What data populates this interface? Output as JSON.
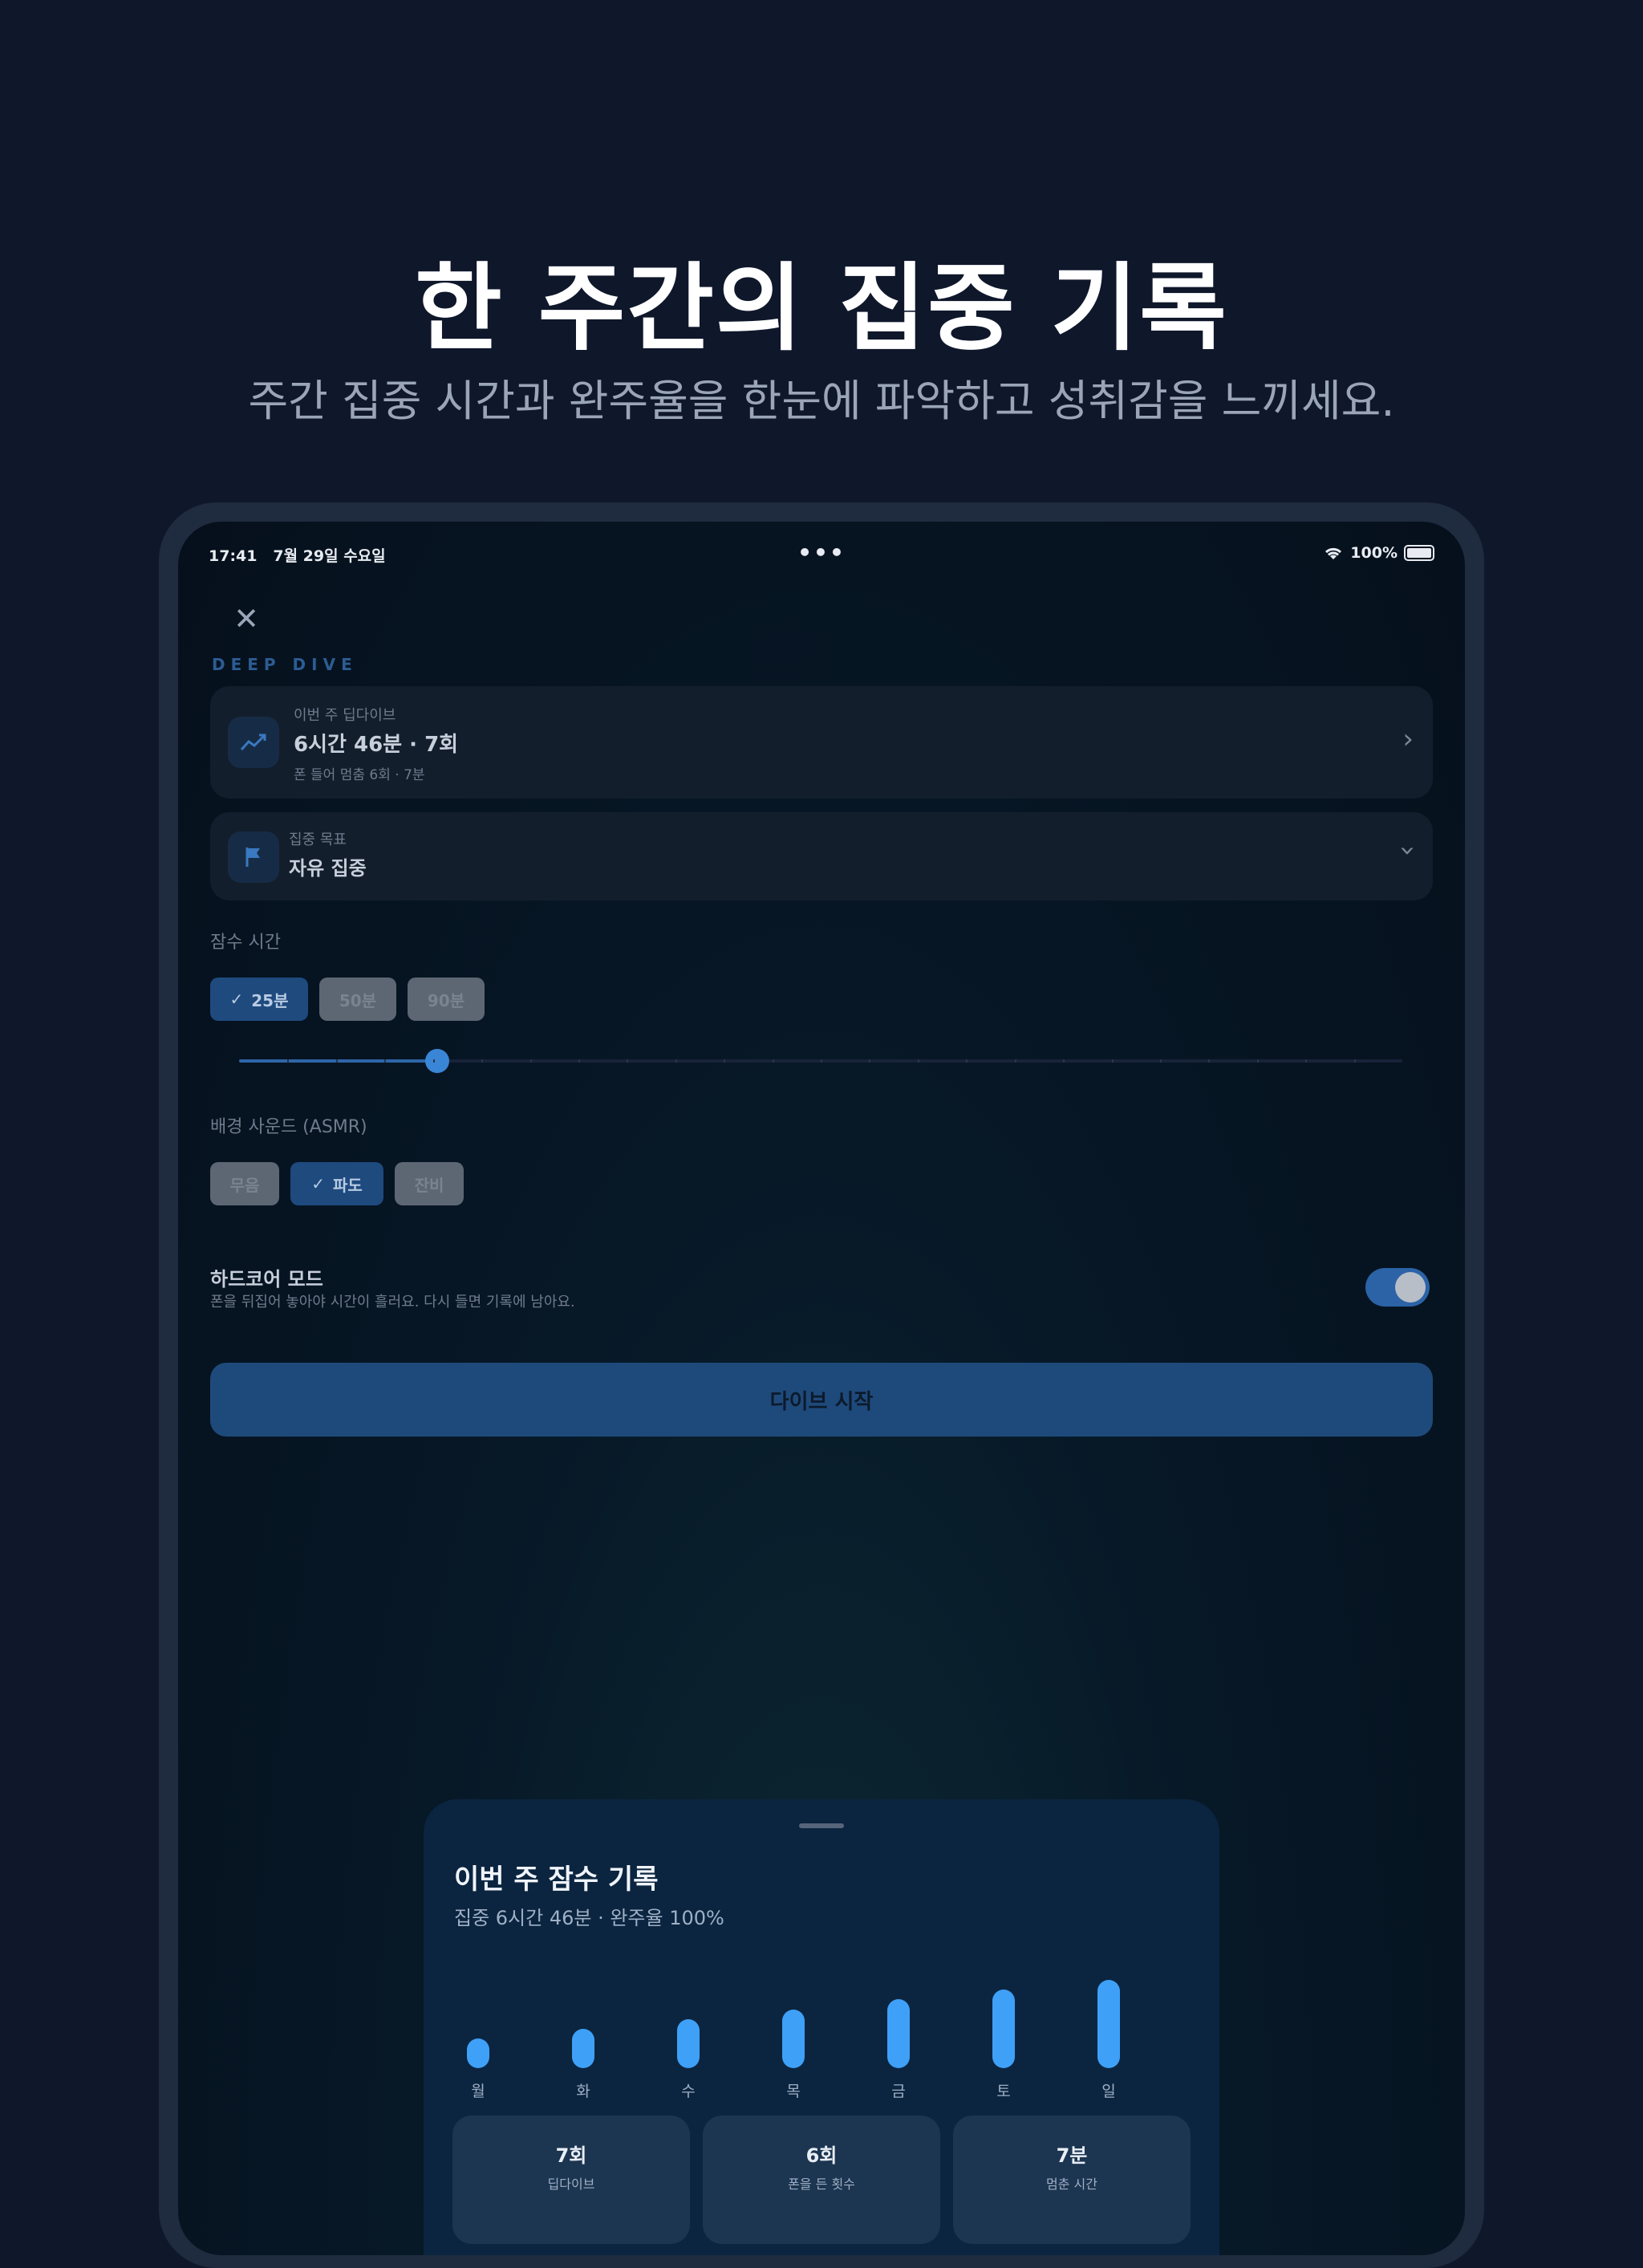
{
  "hero": {
    "title": "한 주간의 집중 기록",
    "subtitle": "주간 집중 시간과 완주율을 한눈에 파악하고 성취감을 느끼세요."
  },
  "status_bar": {
    "time": "17:41",
    "date": "7월 29일 수요일",
    "battery": "100%"
  },
  "app": {
    "brand": "DEEP DIVE",
    "weekly_card": {
      "label": "이번 주 딥다이브",
      "value": "6시간 46분 · 7회",
      "sub": "폰 들어 멈춤 6회 · 7분"
    },
    "goal_card": {
      "label": "집중 목표",
      "value": "자유 집중"
    },
    "dive_time": {
      "label": "잠수 시간",
      "options": [
        "25분",
        "50분",
        "90분"
      ],
      "selected": "25분",
      "slider_fraction": 0.17
    },
    "sound": {
      "label": "배경 사운드 (ASMR)",
      "options": [
        "무음",
        "파도",
        "잔비"
      ],
      "selected": "파도"
    },
    "hardcore": {
      "title": "하드코어 모드",
      "desc": "폰을 뒤집어 놓아야 시간이 흘러요. 다시 들면 기록에 남아요.",
      "enabled": true
    },
    "start_button": "다이브 시작"
  },
  "sheet": {
    "title": "이번 주 잠수 기록",
    "subtitle": "집중 6시간 46분 · 완주율 100%"
  },
  "chart_data": {
    "type": "bar",
    "categories": [
      "월",
      "화",
      "수",
      "목",
      "금",
      "토",
      "일"
    ],
    "values": [
      3,
      4,
      5,
      6,
      7,
      8,
      9
    ]
  },
  "stats": [
    {
      "value": "7회",
      "label": "딥다이브"
    },
    {
      "value": "6회",
      "label": "폰을 든 횟수"
    },
    {
      "value": "7분",
      "label": "멈춘 시간"
    }
  ],
  "colors": {
    "background": "#0f172b",
    "accent": "#3fa0f7",
    "sheet": "#0b2540"
  }
}
